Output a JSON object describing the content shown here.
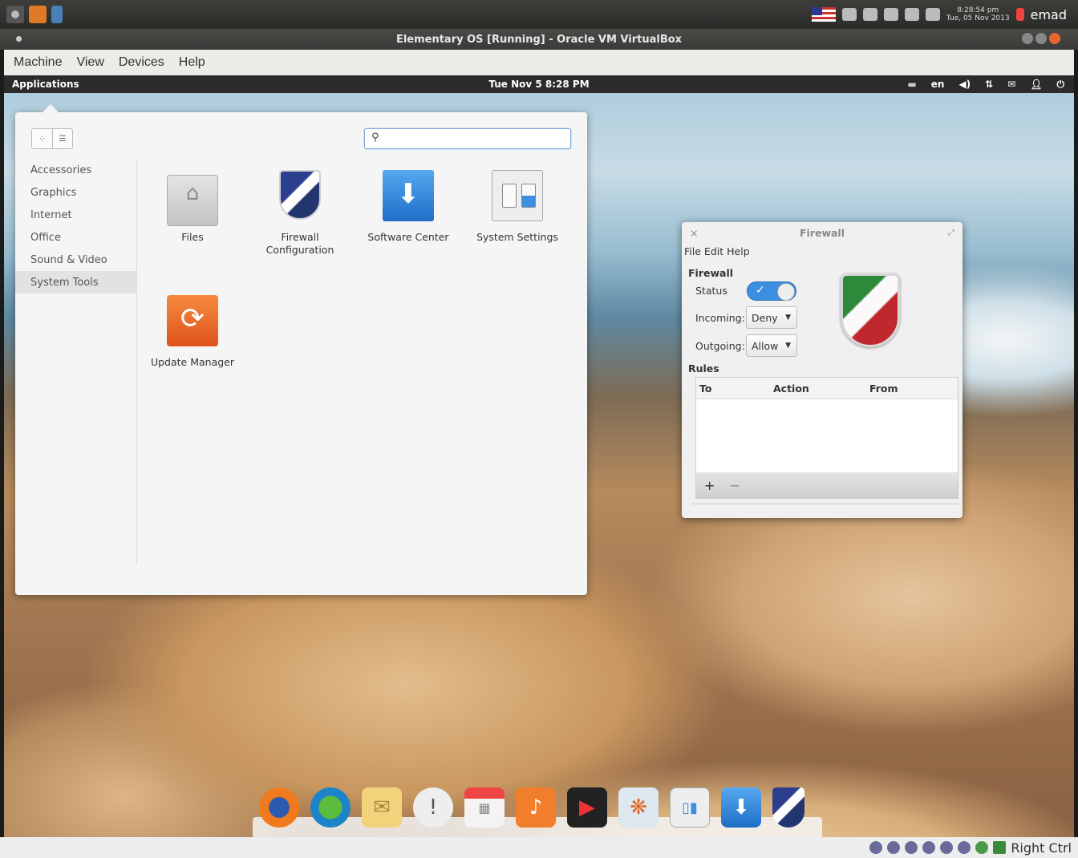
{
  "host": {
    "clock_time": "8:28:54 pm",
    "clock_date": "Tue, 05 Nov 2013",
    "user": "emad"
  },
  "vm_window": {
    "title": "Elementary OS [Running] - Oracle VM VirtualBox",
    "menu": [
      "Machine",
      "View",
      "Devices",
      "Help"
    ],
    "host_key": "Right Ctrl"
  },
  "panel": {
    "applications": "Applications",
    "time": "Tue Nov  5  8:28 PM",
    "language": "en"
  },
  "launcher": {
    "search_placeholder": "",
    "categories": [
      "Accessories",
      "Graphics",
      "Internet",
      "Office",
      "Sound & Video",
      "System Tools"
    ],
    "selected_category": "System Tools",
    "apps": [
      {
        "name": "Files",
        "icon": "folder-icon"
      },
      {
        "name": "Firewall\nConfiguration",
        "icon": "firewall-shield-icon"
      },
      {
        "name": "Software Center",
        "icon": "software-center-icon"
      },
      {
        "name": "System Settings",
        "icon": "settings-icon"
      },
      {
        "name": "Update Manager",
        "icon": "update-manager-icon"
      }
    ]
  },
  "firewall": {
    "title": "Firewall",
    "menu": [
      "File",
      "Edit",
      "Help"
    ],
    "section": "Firewall",
    "status_label": "Status",
    "status_on": true,
    "incoming_label": "Incoming:",
    "incoming_value": "Deny",
    "outgoing_label": "Outgoing:",
    "outgoing_value": "Allow",
    "rules_label": "Rules",
    "columns": [
      "To",
      "Action",
      "From"
    ],
    "add": "+",
    "remove": "−"
  },
  "dock": [
    "firefox-icon",
    "browser-globe-icon",
    "mail-icon",
    "notifications-icon",
    "calendar-icon",
    "music-icon",
    "video-icon",
    "photos-icon",
    "settings-icon",
    "software-center-icon",
    "firewall-shield-icon"
  ]
}
